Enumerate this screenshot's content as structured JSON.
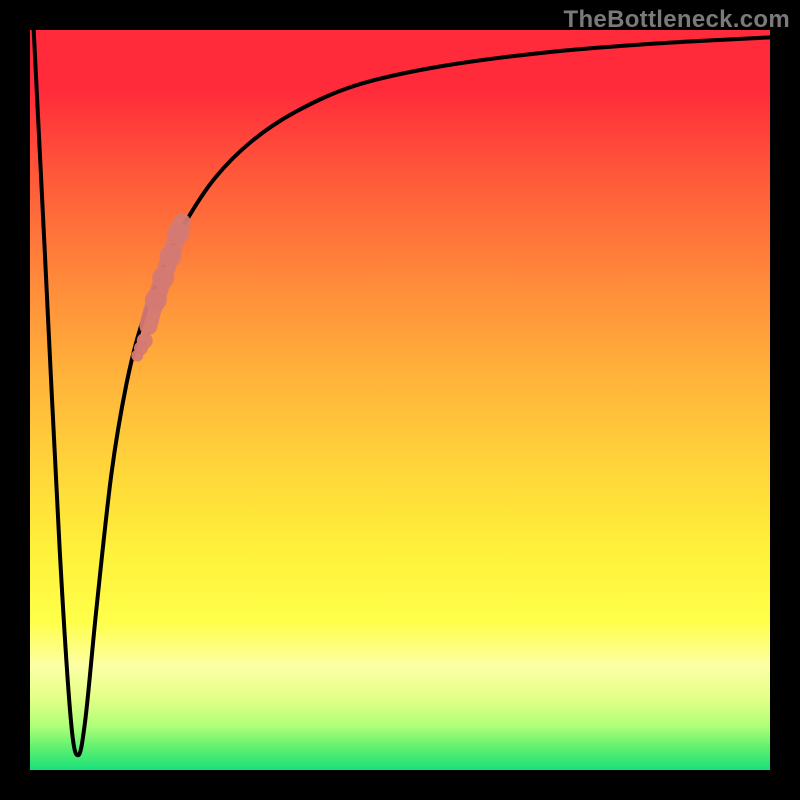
{
  "watermark": "TheBottleneck.com",
  "colors": {
    "frame": "#000000",
    "gradient_top": "#ff2a3a",
    "gradient_bottom": "#18e07a",
    "curve_stroke": "#000000",
    "highlight_dots": "#d57a73"
  },
  "chart_data": {
    "type": "line",
    "title": "",
    "xlabel": "",
    "ylabel": "",
    "xlim": [
      0,
      100
    ],
    "ylim": [
      0,
      100
    ],
    "legend": false,
    "grid": false,
    "annotations": [],
    "series": [
      {
        "name": "bottleneck-curve",
        "x": [
          0.5,
          2,
          4,
          5.5,
          6.5,
          7.5,
          9,
          11,
          13,
          15,
          18,
          21,
          25,
          30,
          36,
          44,
          55,
          70,
          85,
          100
        ],
        "values": [
          100,
          70,
          30,
          7,
          2,
          7,
          22,
          40,
          52,
          60,
          68,
          74,
          80,
          85,
          89,
          92.5,
          95,
          97,
          98.2,
          99
        ],
        "note": "Percent bottleneck vs. normalized x. Values are read off the plotted curve; axes themselves are unlabeled in the source image."
      }
    ],
    "highlight": {
      "name": "highlighted-segment",
      "description": "Pink dot/blob overlay along the ascending branch of the curve",
      "x": [
        14.5,
        15,
        15.5,
        16.0,
        16.5,
        17.0,
        17.5,
        18.0,
        18.5,
        19.0,
        19.5,
        20.0,
        20.5
      ],
      "values": [
        56,
        57,
        58,
        60,
        62,
        63.5,
        65,
        66.5,
        68,
        69.5,
        71,
        72.5,
        74
      ]
    }
  }
}
